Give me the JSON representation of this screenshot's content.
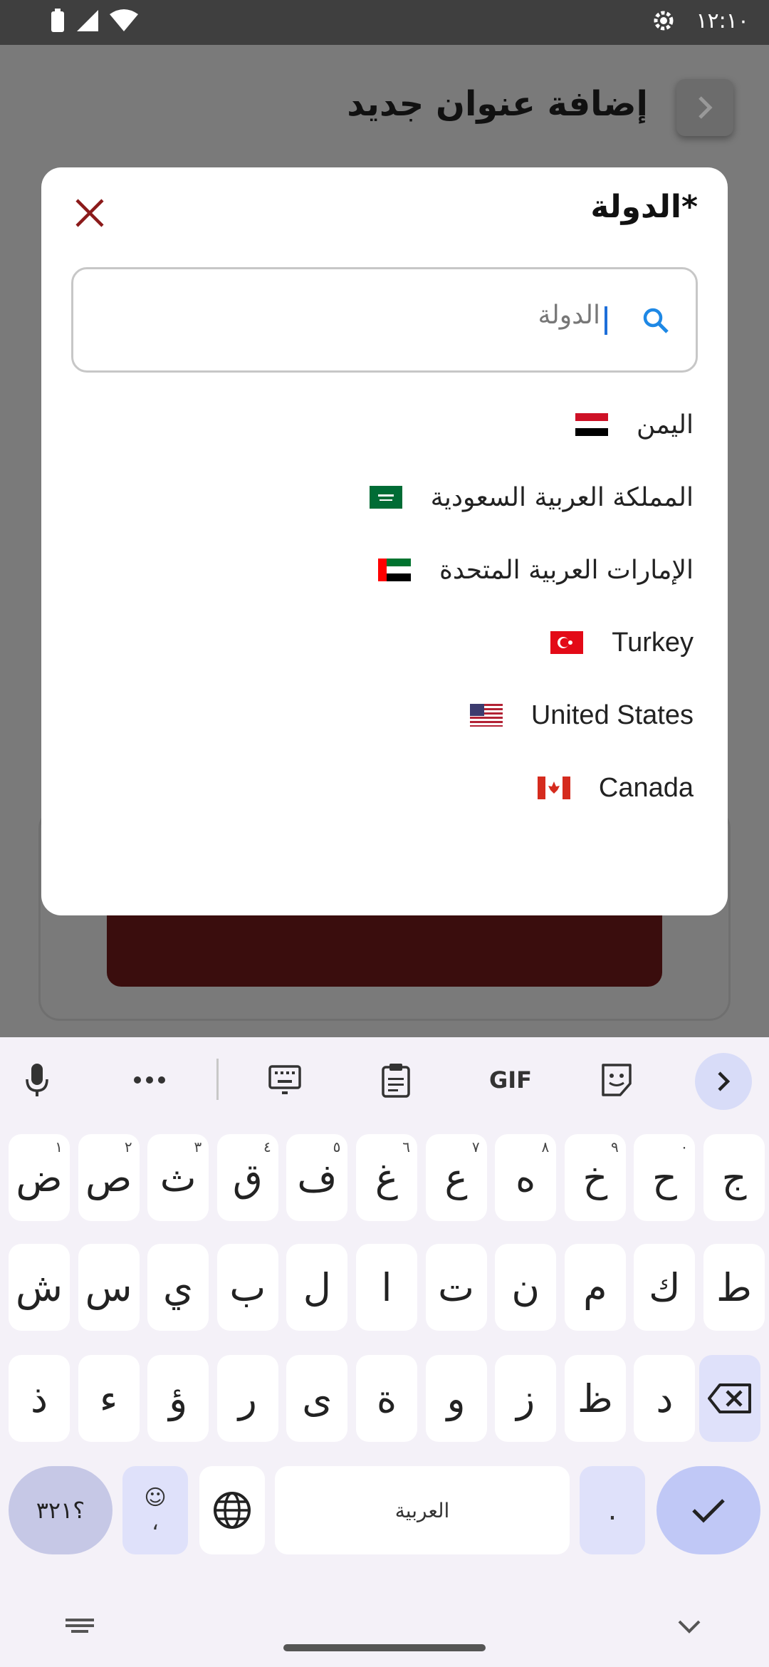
{
  "status_bar": {
    "time": "١٢:١٠"
  },
  "app": {
    "title": "إضافة عنوان جديد"
  },
  "dialog": {
    "title": "*الدولة",
    "search": {
      "placeholder": "الدولة"
    },
    "countries": [
      {
        "name": "اليمن",
        "flag": "yemen"
      },
      {
        "name": "المملكة العربية السعودية",
        "flag": "saudi-arabia"
      },
      {
        "name": "الإمارات العربية المتحدة",
        "flag": "uae"
      },
      {
        "name": "Turkey",
        "flag": "turkey"
      },
      {
        "name": "United States",
        "flag": "united-states"
      },
      {
        "name": "Canada",
        "flag": "canada"
      }
    ]
  },
  "keyboard": {
    "toolbar": {
      "gif_label": "GIF"
    },
    "row1": [
      {
        "char": "ض",
        "hint": "١"
      },
      {
        "char": "ص",
        "hint": "٢"
      },
      {
        "char": "ث",
        "hint": "٣"
      },
      {
        "char": "ق",
        "hint": "٤"
      },
      {
        "char": "ف",
        "hint": "٥"
      },
      {
        "char": "غ",
        "hint": "٦"
      },
      {
        "char": "ع",
        "hint": "٧"
      },
      {
        "char": "ه",
        "hint": "٨"
      },
      {
        "char": "خ",
        "hint": "٩"
      },
      {
        "char": "ح",
        "hint": "٠"
      },
      {
        "char": "ج",
        "hint": ""
      }
    ],
    "row2": [
      "ش",
      "س",
      "ي",
      "ب",
      "ل",
      "ا",
      "ت",
      "ن",
      "م",
      "ك",
      "ط"
    ],
    "row3": [
      "ذ",
      "ء",
      "ؤ",
      "ر",
      "ى",
      "ة",
      "و",
      "ز",
      "ظ",
      "د"
    ],
    "symbols_label": "؟٣٢١",
    "emoji_label": "☺",
    "emoji_comma": "،",
    "space_label": "العربية",
    "period_label": ".",
    "colors": {
      "accent": "#c0c8f6",
      "key": "#ffffff",
      "special": "#dfe1fa"
    }
  },
  "colors": {
    "close_icon": "#8b1a1a",
    "search_icon": "#1e88e5",
    "dialog_bg": "#ffffff"
  }
}
